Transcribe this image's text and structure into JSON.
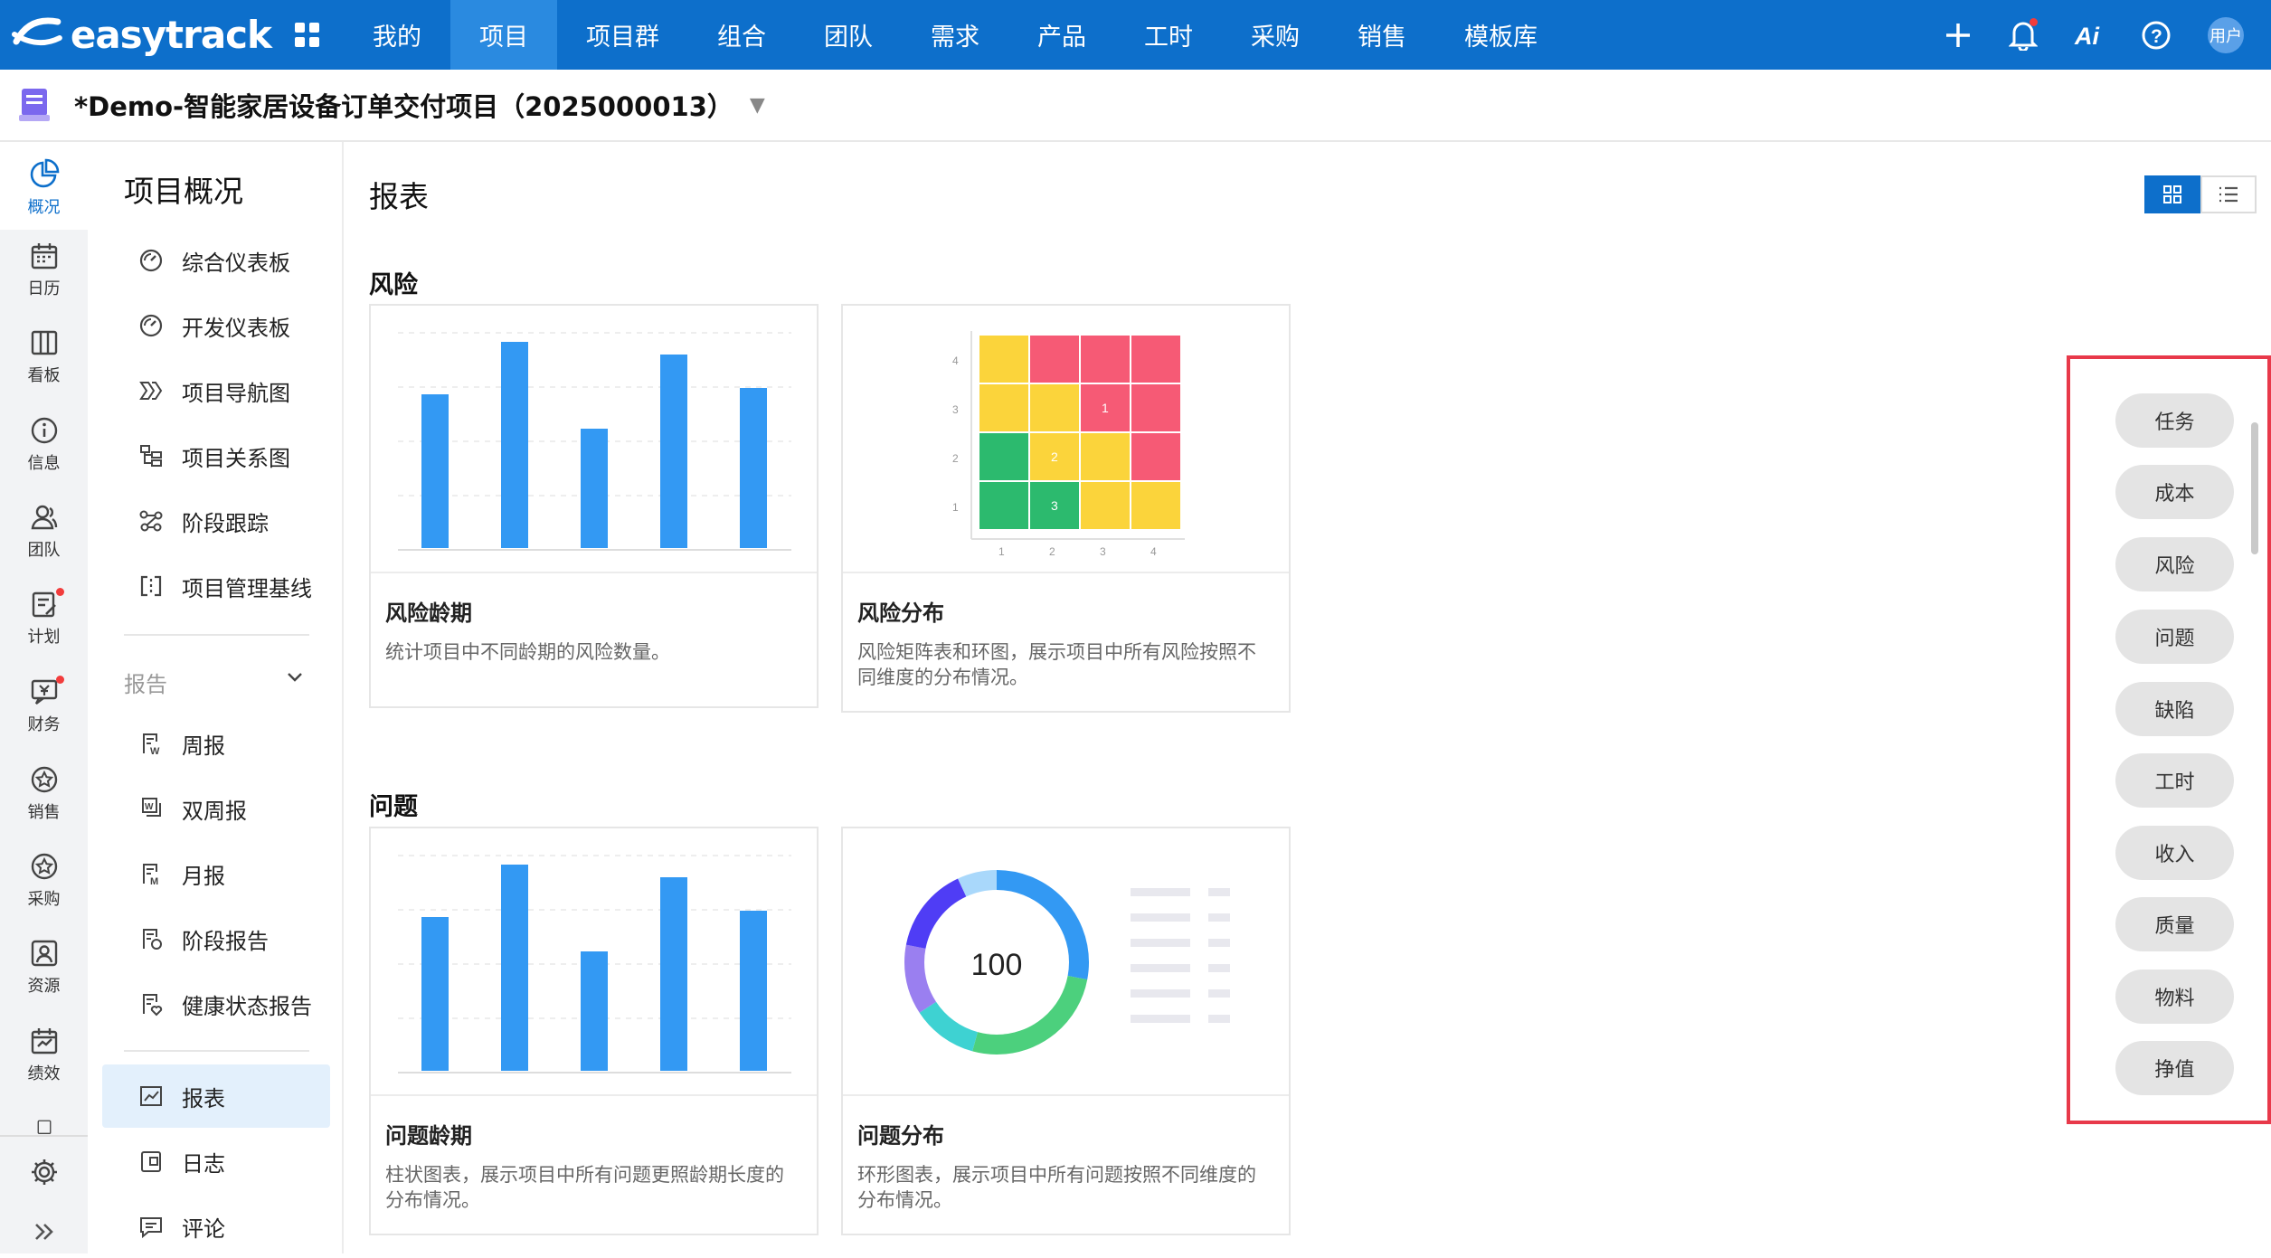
{
  "topbar": {
    "brand": "easytrack",
    "nav": [
      "我的",
      "项目",
      "项目群",
      "组合",
      "团队",
      "需求",
      "产品",
      "工时",
      "采购",
      "销售",
      "模板库"
    ],
    "active_nav": "项目",
    "user_label": "用户"
  },
  "project": {
    "title": "*Demo-智能家居设备订单交付项目（2025000013）"
  },
  "rail": {
    "items": [
      "概况",
      "日历",
      "看板",
      "信息",
      "团队",
      "计划",
      "财务",
      "销售",
      "采购",
      "资源",
      "绩效"
    ]
  },
  "sidebar": {
    "title": "项目概况",
    "items": [
      "综合仪表板",
      "开发仪表板",
      "项目导航图",
      "项目关系图",
      "阶段跟踪",
      "项目管理基线"
    ],
    "group_label": "报告",
    "report_items": [
      "周报",
      "双周报",
      "月报",
      "阶段报告",
      "健康状态报告"
    ],
    "bottom_items": [
      "报表",
      "日志",
      "评论"
    ]
  },
  "main": {
    "page_title": "报表",
    "sections": [
      {
        "title": "风险",
        "cards": [
          {
            "title": "风险龄期",
            "desc": "统计项目中不同龄期的风险数量。"
          },
          {
            "title": "风险分布",
            "desc": "风险矩阵表和环图，展示项目中所有风险按照不同维度的分布情况。"
          }
        ]
      },
      {
        "title": "问题",
        "cards": [
          {
            "title": "问题龄期",
            "desc": "柱状图表，展示项目中所有问题更照龄期长度的分布情况。"
          },
          {
            "title": "问题分布",
            "desc": "环形图表，展示项目中所有问题按照不同维度的分布情况。"
          }
        ]
      }
    ],
    "matrix_axis_y": [
      "4",
      "3",
      "2",
      "1"
    ],
    "matrix_axis_x": [
      "1",
      "2",
      "3",
      "4"
    ],
    "matrix_values": [
      "1",
      "2",
      "3"
    ],
    "donut_value": "100"
  },
  "filters": [
    "任务",
    "成本",
    "风险",
    "问题",
    "缺陷",
    "工时",
    "收入",
    "质量",
    "物料",
    "挣值"
  ],
  "colors": {
    "brand": "#0d6fcb",
    "bar": "#3399f3",
    "matrix_red": "#f65a75",
    "matrix_yellow": "#fbd43b",
    "matrix_green": "#2cba6e",
    "highlight": "#e8394a"
  }
}
